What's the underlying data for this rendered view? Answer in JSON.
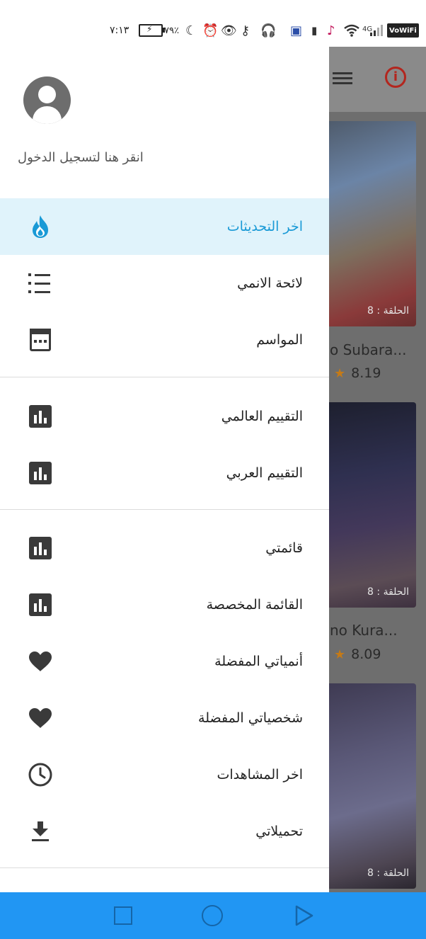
{
  "status_bar": {
    "time": "٧:١٣",
    "battery_percent": "٧٩٪",
    "network": "4G",
    "carrier_badge": "VoWiFi",
    "icons": [
      "battery-charging-icon",
      "moon-icon",
      "alarm-icon",
      "eye-icon",
      "key-icon",
      "headphones-icon",
      "app-notification-icon",
      "battery-saver-icon",
      "tiktok-icon",
      "wifi-icon",
      "signal-icon"
    ]
  },
  "drawer": {
    "login_prompt": "انقر هنا لتسجيل الدخول",
    "active_color": "#1a9ad6",
    "active_bg": "#e0f3fb",
    "items": [
      {
        "label": "اخر التحديثات",
        "icon": "fire-icon",
        "active": true
      },
      {
        "label": "لائحة الانمي",
        "icon": "list-icon"
      },
      {
        "label": "المواسم",
        "icon": "calendar-icon"
      },
      {
        "label": "التقييم العالمي",
        "icon": "bar-chart-icon"
      },
      {
        "label": "التقييم العربي",
        "icon": "bar-chart-icon"
      },
      {
        "label": "قائمتي",
        "icon": "bar-chart-icon"
      },
      {
        "label": "القائمة المخصصة",
        "icon": "bar-chart-icon"
      },
      {
        "label": "أنمياتي المفضلة",
        "icon": "heart-icon"
      },
      {
        "label": "شخصياتي المفضلة",
        "icon": "heart-icon"
      },
      {
        "label": "اخر المشاهدات",
        "icon": "clock-icon"
      },
      {
        "label": "تحميلاتي",
        "icon": "download-icon"
      }
    ]
  },
  "background": {
    "cards": [
      {
        "episode": "الحلقة : 8",
        "title": "o Subara...",
        "rating": "8.19"
      },
      {
        "episode": "الحلقة : 8",
        "title": "no Kura...",
        "rating": "8.09"
      },
      {
        "episode": "الحلقة : 8"
      }
    ],
    "accent_info_color": "#b3261e",
    "star_color": "#c47a17"
  },
  "navbar": {
    "color": "#2196f3",
    "buttons": [
      "recent-apps-icon",
      "home-icon",
      "back-icon"
    ]
  }
}
